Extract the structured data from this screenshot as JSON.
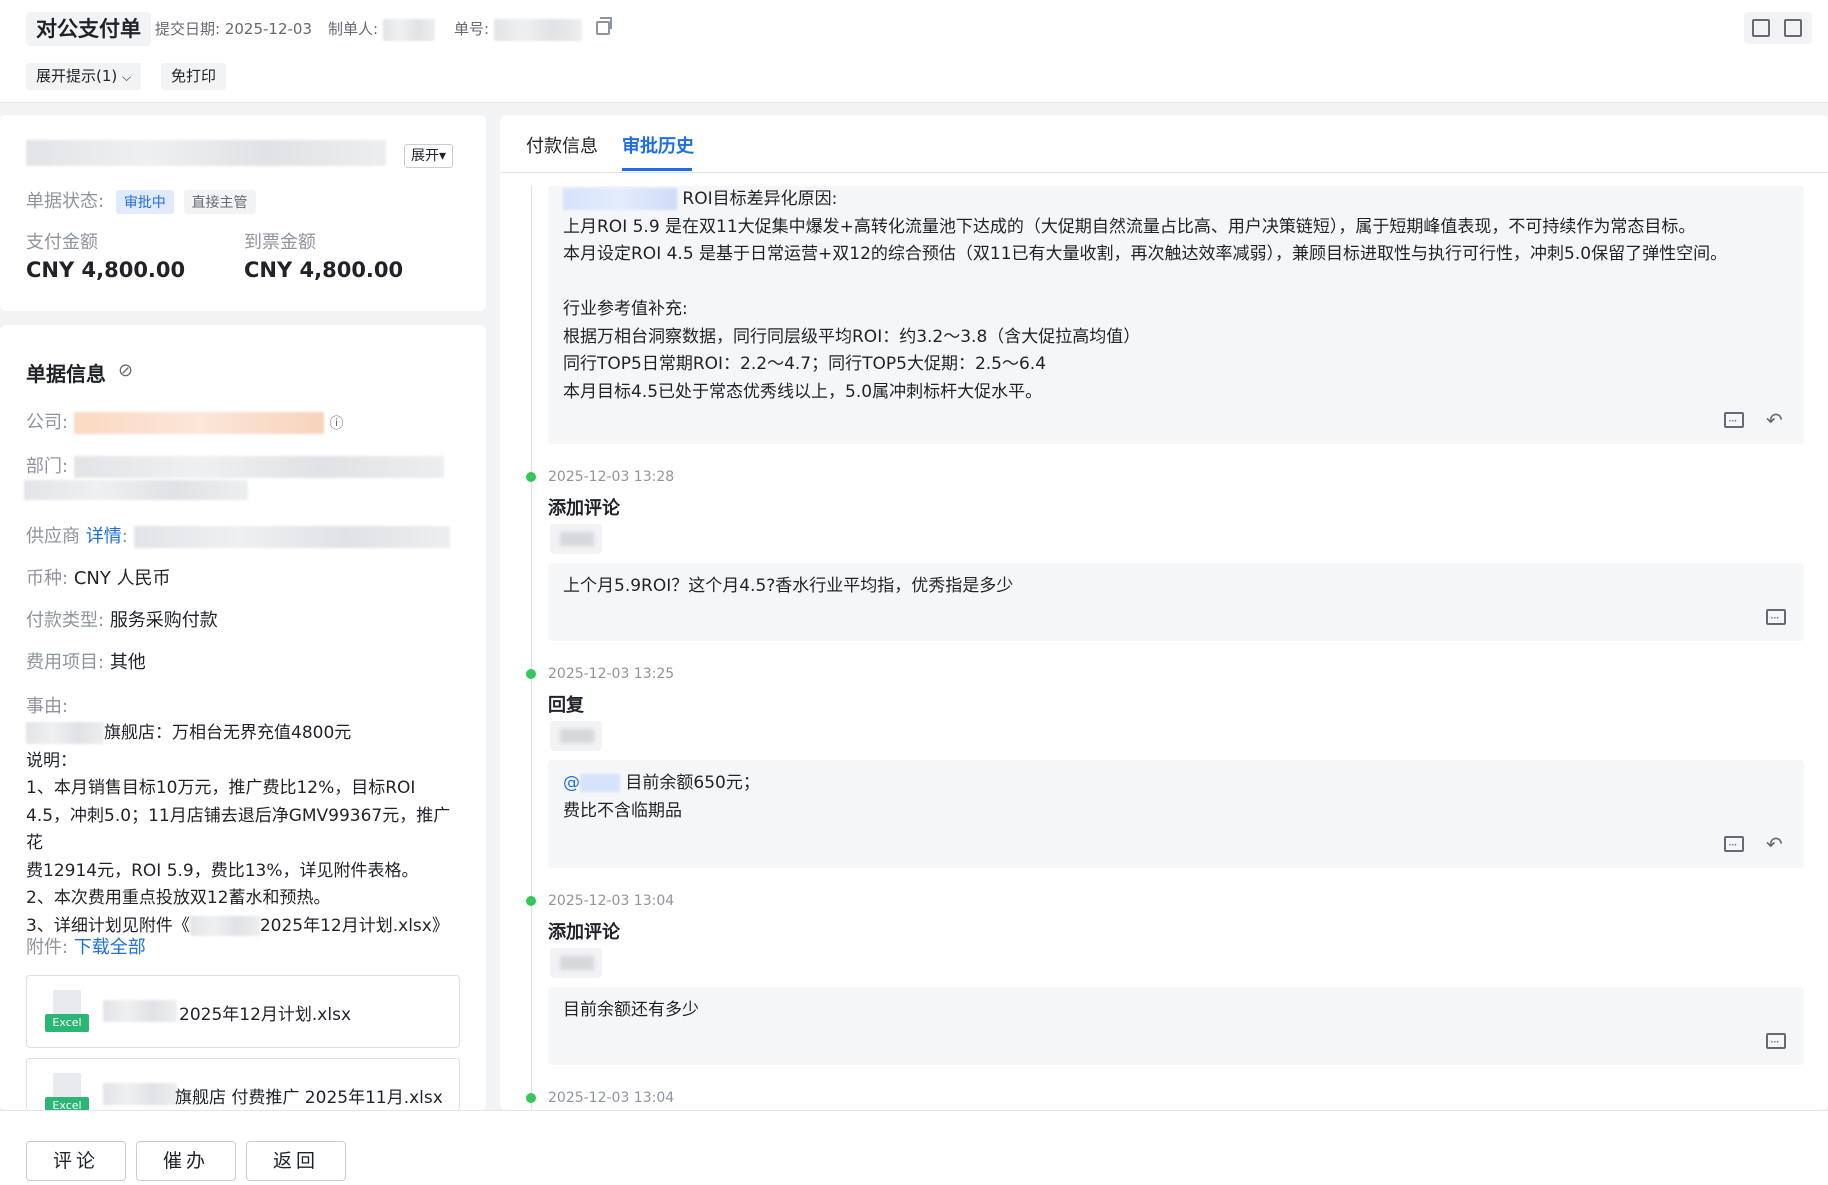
{
  "header": {
    "title": "对公支付单",
    "submit_date_label": "提交日期:",
    "submit_date": "2025-12-03",
    "creator_label": "制单人:",
    "doc_no_label": "单号:",
    "expand_tips_label": "展开提示(1)",
    "no_print_label": "免打印"
  },
  "summary": {
    "expand_label": "展开",
    "status_label": "单据状态:",
    "status_badge": "审批中",
    "approver_badge": "直接主管",
    "pay_amount_label": "支付金额",
    "pay_amount": "CNY 4,800.00",
    "invoice_amount_label": "到票金额",
    "invoice_amount": "CNY 4,800.00"
  },
  "doc_info": {
    "section_title": "单据信息",
    "company_label": "公司:",
    "department_label": "部门:",
    "supplier_label": "供应商",
    "supplier_detail_link": "详情",
    "currency_label": "币种:",
    "currency_value": "CNY 人民币",
    "pay_type_label": "付款类型:",
    "pay_type_value": "服务采购付款",
    "expense_label": "费用项目:",
    "expense_value": "其他",
    "reason_label": "事由:",
    "reason_lines": [
      "旗舰店：万相台无界充值4800元",
      "说明：",
      "1、本月销售目标10万元，推广费比12%，目标ROI",
      "4.5，冲刺5.0；11月店铺去退后净GMV99367元，推广花",
      "费12914元，ROI 5.9，费比13%，详见附件表格。",
      "2、本次费用重点投放双12蓄水和预热。",
      "3、详细计划见附件《",
      "2025年12月计划.xlsx》"
    ],
    "attachments_label": "附件:",
    "download_all_link": "下载全部",
    "excel_tag": "Excel",
    "attachments": [
      "2025年12月计划.xlsx",
      "旗舰店 付费推广 2025年11月.xlsx"
    ]
  },
  "tabs": {
    "payment_info": "付款信息",
    "approval_history": "审批历史"
  },
  "history": {
    "first_comment_lines": [
      "ROI目标差异化原因:",
      "上月ROI 5.9 是在双11大促集中爆发+高转化流量池下达成的（大促期自然流量占比高、用户决策链短），属于短期峰值表现，不可持续作为常态目标。",
      "本月设定ROI 4.5 是基于日常运营+双12的综合预估（双11已有大量收割，再次触达效率减弱），兼顾目标进取性与执行可行性，冲刺5.0保留了弹性空间。",
      "",
      "行业参考值补充:",
      "根据万相台洞察数据，同行同层级平均ROI：约3.2～3.8（含大促拉高均值）",
      "同行TOP5日常期ROI：2.2～4.7；同行TOP5大促期：2.5～6.4",
      "本月目标4.5已处于常态优秀线以上，5.0属冲刺标杆大促水平。"
    ],
    "entries": [
      {
        "time": "2025-12-03 13:28",
        "action": "添加评论",
        "text": "上个月5.9ROI？这个月4.5?香水行业平均指，优秀指是多少"
      },
      {
        "time": "2025-12-03 13:25",
        "action": "回复",
        "mention": "@",
        "text": "目前余额650元；",
        "text2": "费比不含临期品"
      },
      {
        "time": "2025-12-03 13:04",
        "action": "添加评论",
        "text": "目前余额还有多少"
      },
      {
        "time": "2025-12-03 13:04"
      }
    ]
  },
  "footer": {
    "comment_label": "评论",
    "urge_label": "催办",
    "back_label": "返回"
  },
  "colors": {
    "accent": "#1f6fe0",
    "status_bg": "#e1eaff",
    "timeline_dot": "#34c759"
  }
}
